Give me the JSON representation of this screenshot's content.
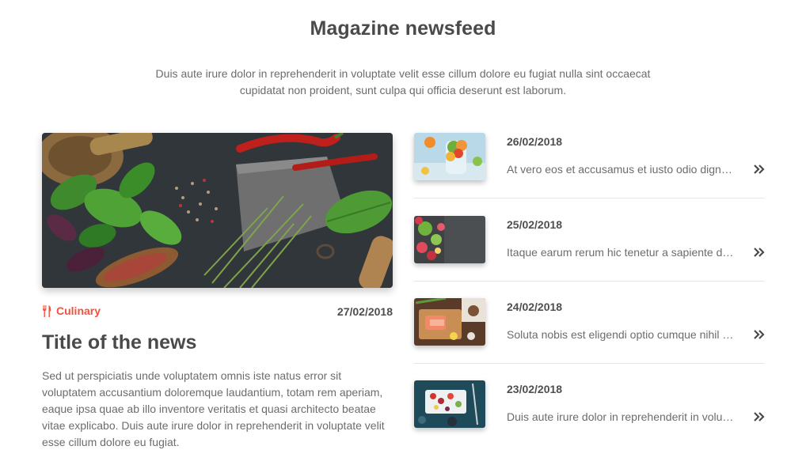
{
  "header": {
    "title": "Magazine newsfeed",
    "intro": "Duis aute irure dolor in reprehenderit in voluptate velit esse cillum dolore eu fugiat nulla sint occaecat cupidatat non proident, sunt culpa qui officia deserunt est laborum."
  },
  "featured": {
    "category": "Culinary",
    "category_icon": "utensils-icon",
    "date": "27/02/2018",
    "title": "Title of the news",
    "text": "Sed ut perspiciatis unde voluptatem omnis iste natus error sit voluptatem accusantium doloremque laudantium, totam rem aperiam, eaque ipsa quae ab illo inventore veritatis et quasi architecto beatae vitae explicabo. Duis aute irure dolor in reprehenderit in voluptate velit esse cillum dolore eu fugiat."
  },
  "news": [
    {
      "date": "26/02/2018",
      "excerpt": "At vero eos et accusamus et iusto odio dignissimos ducimus qui blanditiis",
      "icon": "double-chevron-right-icon"
    },
    {
      "date": "25/02/2018",
      "excerpt": "Itaque earum rerum hic tenetur a sapiente delectus ut aut reiciendis",
      "icon": "double-chevron-right-icon"
    },
    {
      "date": "24/02/2018",
      "excerpt": "Soluta nobis est eligendi optio cumque nihil impedit quo minus",
      "icon": "double-chevron-right-icon"
    },
    {
      "date": "23/02/2018",
      "excerpt": "Duis aute irure dolor in reprehenderit in voluptate velit esse",
      "icon": "double-chevron-right-icon"
    }
  ],
  "colors": {
    "accent": "#f0533d",
    "title": "#4a4a4a",
    "text": "#6c6c6c",
    "divider": "#e6e6e6"
  }
}
